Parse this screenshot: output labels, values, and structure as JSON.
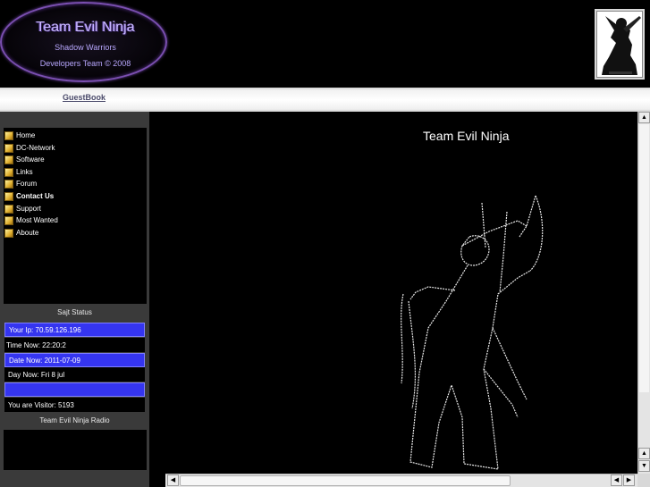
{
  "header": {
    "title": "Team Evil Ninja",
    "subtitle": "Shadow Warriors",
    "tagline": "Developers Team  © 2008"
  },
  "nav": {
    "guestbook": "GuestBook"
  },
  "menu": [
    {
      "label": "Home"
    },
    {
      "label": "DC-Network"
    },
    {
      "label": "Software"
    },
    {
      "label": "Links"
    },
    {
      "label": "Forum"
    },
    {
      "label": "Contact Us"
    },
    {
      "label": "Support"
    },
    {
      "label": "Most Wanted"
    },
    {
      "label": "Aboute"
    }
  ],
  "status": {
    "title": "Sajt Status",
    "ip": "Your Ip: 70.59.126.196",
    "time": "Time Now: 22:20:2",
    "date": "Date Now: 2011-07-09",
    "day": "Day Now: Fri 8 jul",
    "blank": "",
    "visitor": "You are Visitor: 5193"
  },
  "radio": {
    "title": "Team Evil Ninja Radio"
  },
  "main": {
    "title": "Team Evil Ninja"
  },
  "colors": {
    "accent_purple": "#7a4fb0",
    "status_blue": "#3535f0",
    "sidebar_bg": "#3a3a3a"
  },
  "icons": {
    "menu_bullet": "yellow-square-bullet-icon",
    "scroll_up": "arrow-up-icon",
    "scroll_down": "arrow-down-icon",
    "scroll_left": "arrow-left-icon",
    "scroll_right": "arrow-right-icon"
  }
}
